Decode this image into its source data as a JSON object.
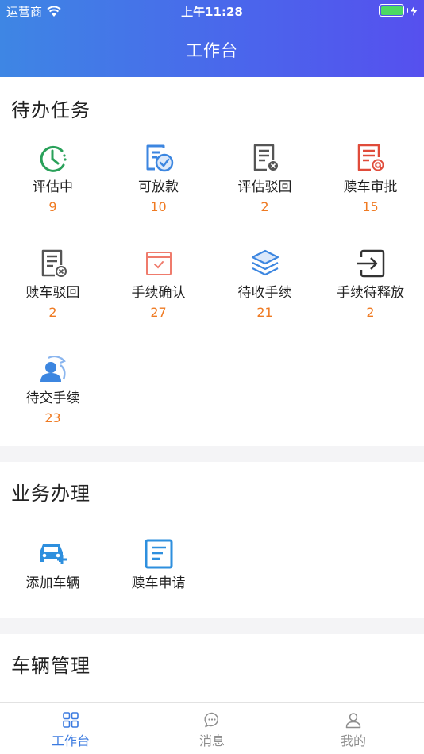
{
  "status_bar": {
    "carrier": "运营商",
    "time": "上午11:28",
    "charging_icon": "bolt-icon"
  },
  "header": {
    "title": "工作台"
  },
  "todo": {
    "title": "待办任务",
    "items": [
      {
        "label": "评估中",
        "count": "9",
        "icon": "clock-icon",
        "color": "#2aa15a"
      },
      {
        "label": "可放款",
        "count": "10",
        "icon": "document-check-icon",
        "color": "#3c86e0"
      },
      {
        "label": "评估驳回",
        "count": "2",
        "icon": "document-reject-icon",
        "color": "#555555"
      },
      {
        "label": "赎车审批",
        "count": "15",
        "icon": "document-at-icon",
        "color": "#e04b3a"
      },
      {
        "label": "赎车驳回",
        "count": "2",
        "icon": "document-reject-icon",
        "color": "#555555"
      },
      {
        "label": "手续确认",
        "count": "27",
        "icon": "calendar-check-icon",
        "color": "#ef7b6c"
      },
      {
        "label": "待收手续",
        "count": "21",
        "icon": "layers-icon",
        "color": "#3c86e0"
      },
      {
        "label": "手续待释放",
        "count": "2",
        "icon": "exit-icon",
        "color": "#333333"
      },
      {
        "label": "待交手续",
        "count": "23",
        "icon": "user-transfer-icon",
        "color": "#3c86e0"
      }
    ]
  },
  "business": {
    "title": "业务办理",
    "items": [
      {
        "label": "添加车辆",
        "icon": "car-add-icon",
        "color": "#2e8fde"
      },
      {
        "label": "赎车申请",
        "icon": "document-list-icon",
        "color": "#2e8fde"
      }
    ]
  },
  "vehicles": {
    "title": "车辆管理"
  },
  "tabbar": {
    "items": [
      {
        "label": "工作台",
        "icon": "grid-icon"
      },
      {
        "label": "消息",
        "icon": "chat-icon"
      },
      {
        "label": "我的",
        "icon": "user-icon"
      }
    ],
    "active_color": "#3c7be0",
    "inactive_color": "#8d8d8d"
  },
  "colors": {
    "accent": "#4b64ec",
    "count": "#ef7a22"
  }
}
